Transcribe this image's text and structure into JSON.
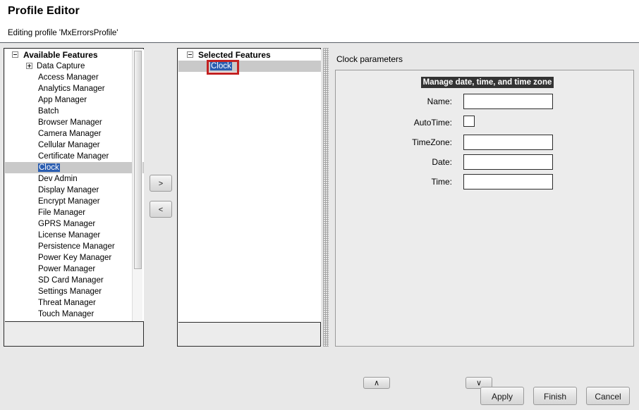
{
  "header": {
    "title": "Profile Editor",
    "subtitle": "Editing profile 'MxErrorsProfile'"
  },
  "available": {
    "root_label": "Available Features",
    "group_label": "Data Capture",
    "items": [
      "Access Manager",
      "Analytics Manager",
      "App Manager",
      "Batch",
      "Browser Manager",
      "Camera Manager",
      "Cellular Manager",
      "Certificate Manager",
      "Clock",
      "Dev Admin",
      "Display Manager",
      "Encrypt Manager",
      "File Manager",
      "GPRS Manager",
      "License Manager",
      "Persistence Manager",
      "Power Key Manager",
      "Power Manager",
      "SD Card Manager",
      "Settings Manager",
      "Threat Manager",
      "Touch Manager"
    ],
    "selected_item": "Clock"
  },
  "transfer": {
    "add_label": ">",
    "remove_label": "<"
  },
  "selected": {
    "root_label": "Selected Features",
    "items": [
      "Clock"
    ],
    "move_up_label": "∧",
    "move_down_label": "∨"
  },
  "params": {
    "title": "Clock parameters",
    "band_label": "Manage date, time, and time zone",
    "fields": [
      {
        "label": "Name:",
        "type": "text",
        "value": ""
      },
      {
        "label": "AutoTime:",
        "type": "checkbox",
        "value": ""
      },
      {
        "label": "TimeZone:",
        "type": "text",
        "value": ""
      },
      {
        "label": "Date:",
        "type": "text",
        "value": ""
      },
      {
        "label": "Time:",
        "type": "text",
        "value": ""
      }
    ]
  },
  "footer": {
    "apply_label": "Apply",
    "finish_label": "Finish",
    "cancel_label": "Cancel"
  },
  "colors": {
    "accent_selection": "#2a5db0",
    "highlight_annotation": "#c32222",
    "band_background": "#333333",
    "panel_background": "#ececec"
  }
}
